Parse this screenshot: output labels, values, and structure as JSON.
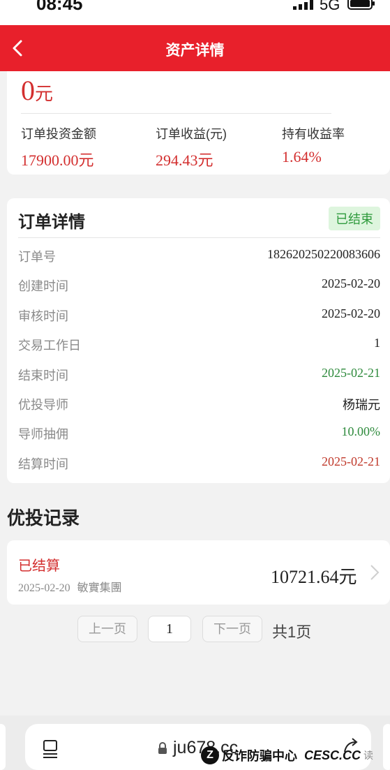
{
  "status_bar": {
    "time": "08:45",
    "network": "5G"
  },
  "header": {
    "title": "资产详情"
  },
  "summary": {
    "balance": "0",
    "balance_unit": "元",
    "stats": [
      {
        "label": "订单投资金额",
        "value": "17900.00元"
      },
      {
        "label": "订单收益(元)",
        "value": "294.43元"
      },
      {
        "label": "持有收益率",
        "value": "1.64%"
      }
    ]
  },
  "order_detail": {
    "title": "订单详情",
    "status": "已结束",
    "rows": [
      {
        "label": "订单号",
        "value": "182620250220083606"
      },
      {
        "label": "创建时间",
        "value": "2025-02-20"
      },
      {
        "label": "审核时间",
        "value": "2025-02-20"
      },
      {
        "label": "交易工作日",
        "value": "1"
      },
      {
        "label": "结束时间",
        "value": "2025-02-21"
      },
      {
        "label": "优投导师",
        "value": "杨瑞元"
      },
      {
        "label": "导师抽佣",
        "value": "10.00%"
      },
      {
        "label": "结算时间",
        "value": "2025-02-21"
      }
    ]
  },
  "records": {
    "title": "优投记录",
    "items": [
      {
        "status": "已结算",
        "date": "2025-02-20",
        "company": "敏實集團",
        "amount": "10721.64元"
      }
    ]
  },
  "pagination": {
    "prev": "上一页",
    "current": "1",
    "next": "下一页",
    "total": "共1页"
  },
  "browser": {
    "url": "ju678.cc"
  },
  "watermark": {
    "logo": "Z",
    "text": "反诈防骗中心",
    "site": "CESC.CC",
    "read": "读"
  },
  "colors": {
    "brand_red": "#e8202b",
    "value_red": "#d32f2f",
    "status_green": "#2e9a3c"
  }
}
